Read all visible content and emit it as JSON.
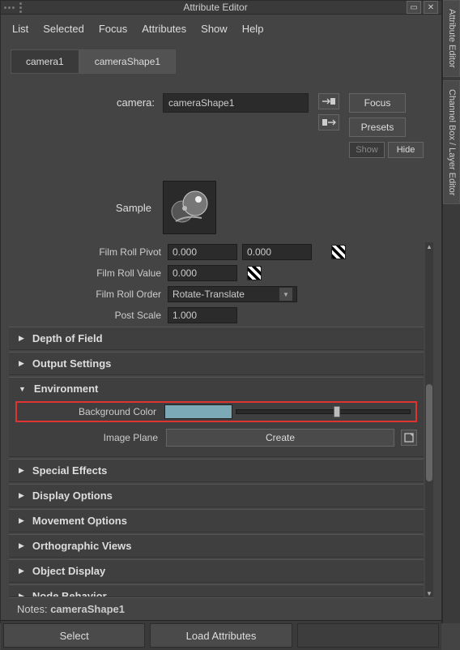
{
  "window": {
    "title": "Attribute Editor"
  },
  "menu": {
    "list": "List",
    "selected": "Selected",
    "focus": "Focus",
    "attributes": "Attributes",
    "show": "Show",
    "help": "Help"
  },
  "side_tabs": {
    "ae": "Attribute Editor",
    "cb": "Channel Box / Layer Editor"
  },
  "node_tabs": {
    "t0": "camera1",
    "t1": "cameraShape1"
  },
  "header": {
    "camera_label": "camera:",
    "camera_value": "cameraShape1",
    "focus": "Focus",
    "presets": "Presets",
    "show": "Show",
    "hide": "Hide",
    "sample_label": "Sample"
  },
  "attrs": {
    "film_roll_pivot": {
      "label": "Film Roll Pivot",
      "x": "0.000",
      "y": "0.000"
    },
    "film_roll_value": {
      "label": "Film Roll Value",
      "v": "0.000"
    },
    "film_roll_order": {
      "label": "Film Roll Order",
      "v": "Rotate-Translate"
    },
    "post_scale": {
      "label": "Post Scale",
      "v": "1.000"
    }
  },
  "sections": {
    "depth": "Depth of Field",
    "output": "Output Settings",
    "env": "Environment",
    "bg_label": "Background Color",
    "image_plane": "Image Plane",
    "create": "Create",
    "sfx": "Special Effects",
    "disp": "Display Options",
    "move": "Movement Options",
    "ortho": "Orthographic Views",
    "obj": "Object Display",
    "node": "Node Behavior"
  },
  "colors": {
    "bg_swatch": "#7ba9b5"
  },
  "notes": {
    "prefix": "Notes:  ",
    "value": "cameraShape1"
  },
  "bottom": {
    "select": "Select",
    "load": "Load Attributes"
  }
}
